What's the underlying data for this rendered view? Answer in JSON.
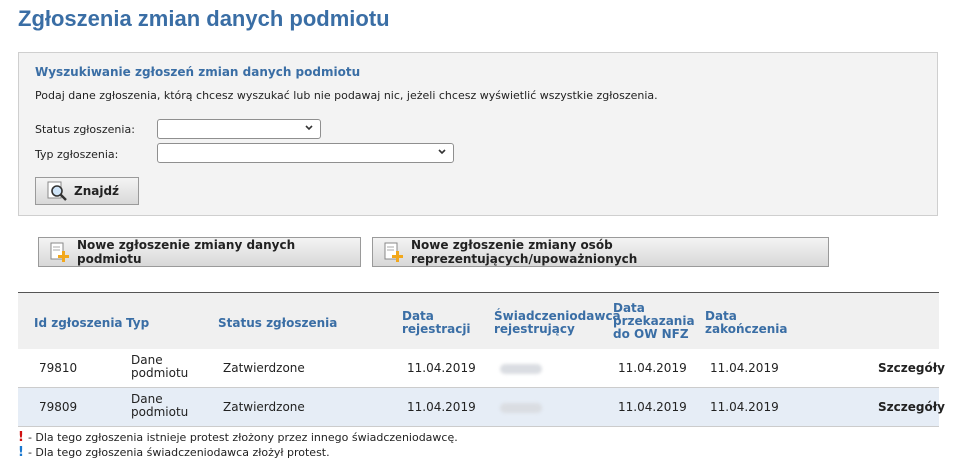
{
  "page": {
    "title": "Zgłoszenia zmian danych podmiotu"
  },
  "search": {
    "title": "Wyszukiwanie zgłoszeń zmian danych podmiotu",
    "description": "Podaj dane zgłoszenia, którą chcesz wyszukać lub nie podawaj nic, jeżeli chcesz wyświetlić wszystkie zgłoszenia.",
    "status_label": "Status zgłoszenia:",
    "status_value": "",
    "type_label": "Typ zgłoszenia:",
    "type_value": "",
    "find_button": "Znajdź"
  },
  "actions": {
    "new_entity_change": "Nowe zgłoszenie zmiany danych podmiotu",
    "new_representatives_change": "Nowe zgłoszenie zmiany osób reprezentujących/upoważnionych"
  },
  "table": {
    "headers": {
      "id": "Id zgłoszenia",
      "type": "Typ",
      "status": "Status zgłoszenia",
      "reg_date_1": "Data",
      "reg_date_2": "rejestracji",
      "provider_1": "Świadczeniodawca",
      "provider_2": "rejestrujący",
      "transfer_1": "Data",
      "transfer_2": "przekazania",
      "transfer_3": "do OW NFZ",
      "end_1": "Data",
      "end_2": "zakończenia"
    },
    "rows": [
      {
        "id": "79810",
        "type_1": "Dane",
        "type_2": "podmiotu",
        "status": "Zatwierdzone",
        "reg_date": "11.04.2019",
        "transfer_date": "11.04.2019",
        "end_date": "11.04.2019",
        "details": "Szczegóły"
      },
      {
        "id": "79809",
        "type_1": "Dane",
        "type_2": "podmiotu",
        "status": "Zatwierdzone",
        "reg_date": "11.04.2019",
        "transfer_date": "11.04.2019",
        "end_date": "11.04.2019",
        "details": "Szczegóły"
      }
    ]
  },
  "legend": {
    "red_mark": "!",
    "red_text": "- Dla tego zgłoszenia istnieje protest złożony przez innego świadczeniodawcę.",
    "blue_mark": "!",
    "blue_text": "- Dla tego zgłoszenia świadczeniodawca złożył protest."
  },
  "colors": {
    "accent": "#3a6ea5",
    "red_mark": "#d01010",
    "blue_mark": "#1a78d0"
  }
}
